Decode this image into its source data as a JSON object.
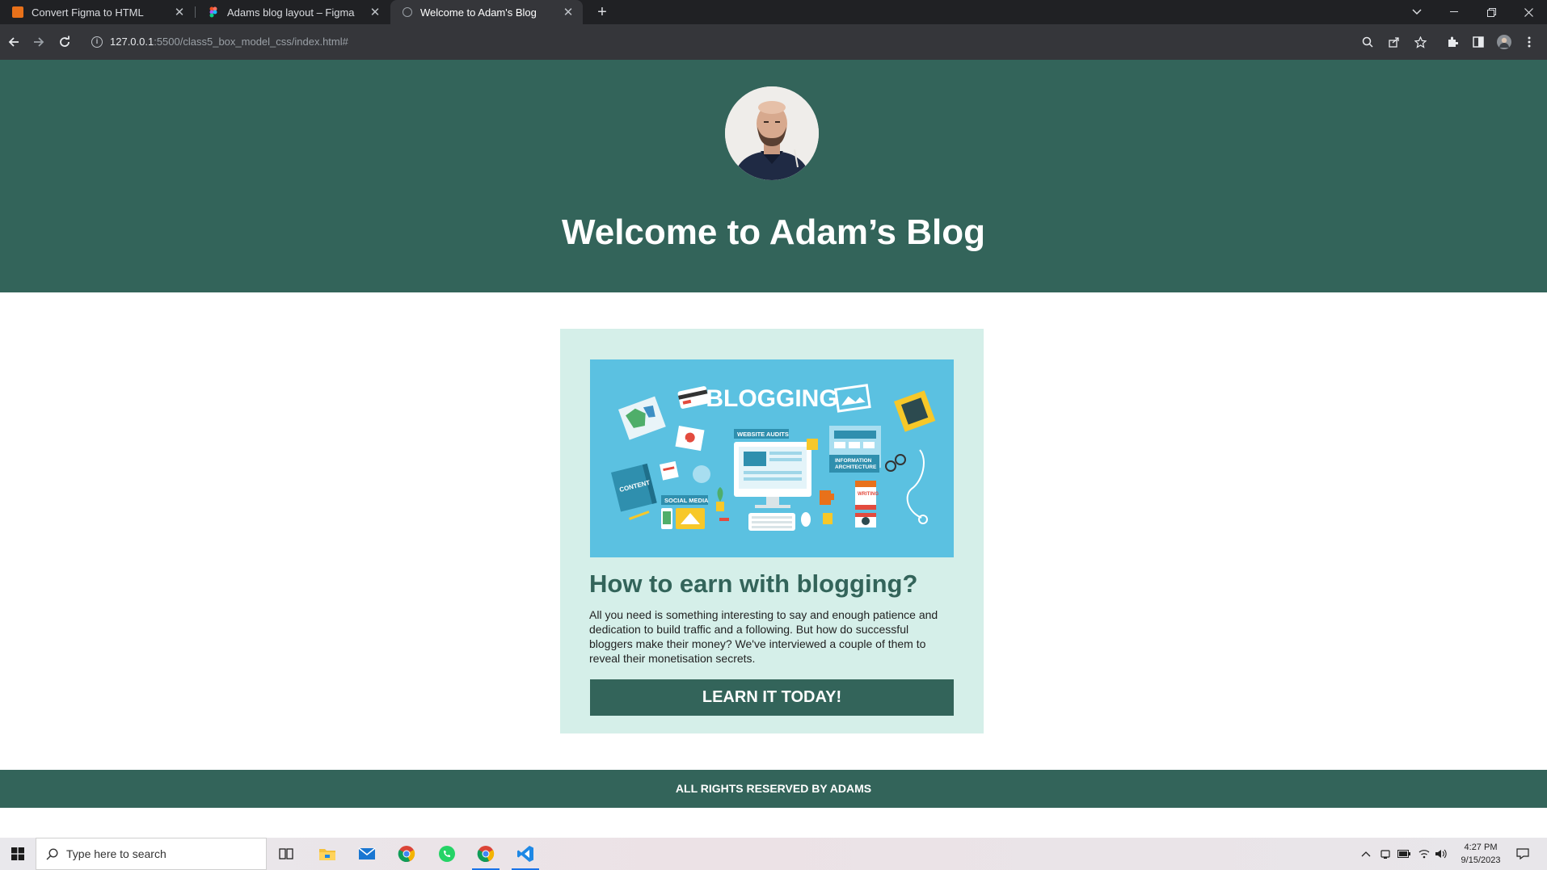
{
  "browser": {
    "tabs": [
      {
        "title": "Convert Figma to HTML"
      },
      {
        "title": "Adams blog layout – Figma"
      },
      {
        "title": "Welcome to Adam's Blog"
      }
    ],
    "url": {
      "host": "127.0.0.1",
      "rest": ":5500/class5_box_model_css/index.html#"
    }
  },
  "page": {
    "heading": "Welcome to Adam’s Blog",
    "card": {
      "image_text": {
        "blogging": "BLOGGING",
        "website_audits": "WEBSITE AUDITS",
        "ux": "UX",
        "content": "CONTENT",
        "social_media": "SOCIAL MEDIA",
        "info_arch_1": "INFORMATION",
        "info_arch_2": "ARCHITECTURE",
        "writing": "WRITING"
      },
      "title": "How to earn with blogging?",
      "body": "All you need is something interesting to say and enough patience and dedication to build traffic and a following. But how do successful bloggers make their money? We've interviewed a couple of them to reveal their monetisation secrets.",
      "button": "LEARN IT TODAY!"
    },
    "footer": "ALL RIGHTS RESERVED BY ADAMS"
  },
  "taskbar": {
    "search_placeholder": "Type here to search",
    "time": "4:27 PM",
    "date": "9/15/2023"
  },
  "colors": {
    "brand_green": "#33645a",
    "card_bg": "#d5efe9",
    "image_bg": "#5bc1e1"
  }
}
